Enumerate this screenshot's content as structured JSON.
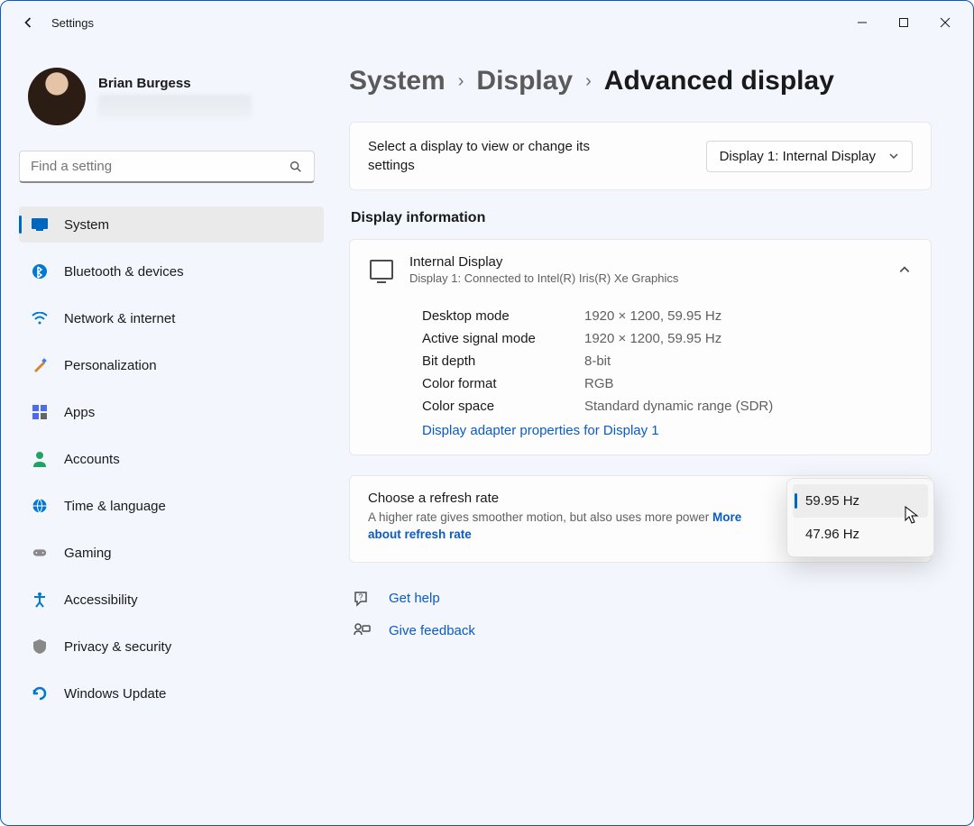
{
  "window": {
    "title": "Settings"
  },
  "profile": {
    "name": "Brian Burgess"
  },
  "search": {
    "placeholder": "Find a setting"
  },
  "nav": [
    {
      "id": "system",
      "label": "System",
      "icon": "🖥️",
      "active": true
    },
    {
      "id": "bluetooth",
      "label": "Bluetooth & devices",
      "icon": "bt"
    },
    {
      "id": "network",
      "label": "Network & internet",
      "icon": "wifi"
    },
    {
      "id": "personalize",
      "label": "Personalization",
      "icon": "brush"
    },
    {
      "id": "apps",
      "label": "Apps",
      "icon": "apps"
    },
    {
      "id": "accounts",
      "label": "Accounts",
      "icon": "person"
    },
    {
      "id": "time",
      "label": "Time & language",
      "icon": "globe"
    },
    {
      "id": "gaming",
      "label": "Gaming",
      "icon": "gamepad"
    },
    {
      "id": "accessibility",
      "label": "Accessibility",
      "icon": "access"
    },
    {
      "id": "privacy",
      "label": "Privacy & security",
      "icon": "shield"
    },
    {
      "id": "update",
      "label": "Windows Update",
      "icon": "update"
    }
  ],
  "breadcrumb": {
    "a": "System",
    "b": "Display",
    "c": "Advanced display"
  },
  "select_display": {
    "label": "Select a display to view or change its settings",
    "value": "Display 1: Internal Display"
  },
  "section": {
    "info_title": "Display information"
  },
  "display_info": {
    "title": "Internal Display",
    "subtitle": "Display 1: Connected to Intel(R) Iris(R) Xe Graphics",
    "props": [
      {
        "label": "Desktop mode",
        "value": "1920 × 1200, 59.95 Hz"
      },
      {
        "label": "Active signal mode",
        "value": "1920 × 1200, 59.95 Hz"
      },
      {
        "label": "Bit depth",
        "value": "8-bit"
      },
      {
        "label": "Color format",
        "value": "RGB"
      },
      {
        "label": "Color space",
        "value": "Standard dynamic range (SDR)"
      }
    ],
    "adapter_link": "Display adapter properties for Display 1"
  },
  "refresh": {
    "title": "Choose a refresh rate",
    "desc": "A higher rate gives smoother motion, but also uses more power  ",
    "more_link": "More about refresh rate",
    "options": [
      {
        "label": "59.95 Hz",
        "selected": true
      },
      {
        "label": "47.96 Hz",
        "selected": false
      }
    ]
  },
  "help": {
    "get_help": "Get help",
    "feedback": "Give feedback"
  }
}
